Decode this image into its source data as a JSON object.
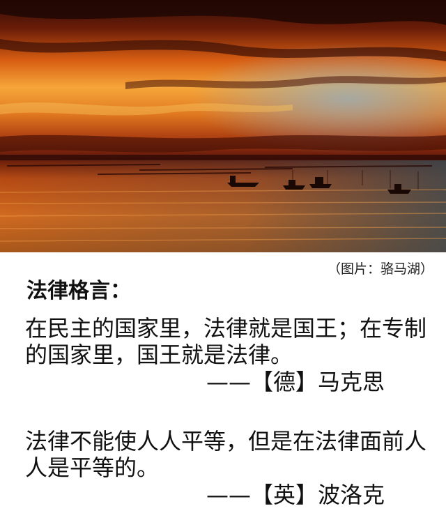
{
  "photo": {
    "subject": "sunset over lake with silhouetted fishing boats",
    "colors": {
      "sky_top": "#3a0d06",
      "sky_glow": "#f08a1e",
      "horizon": "#7a1d0c",
      "water": "#c0601c",
      "water_right": "#3f4a52"
    }
  },
  "credit": "（图片：骆马湖）",
  "heading": "法律格言：",
  "quotes": [
    {
      "text": "在民主的国家里，法律就是国王；在专制的国家里，国王就是法律。",
      "attribution": "——【德】马克思"
    },
    {
      "text": "法律不能使人人平等，但是在法律面前人人是平等的。",
      "attribution": "——【英】波洛克"
    }
  ]
}
